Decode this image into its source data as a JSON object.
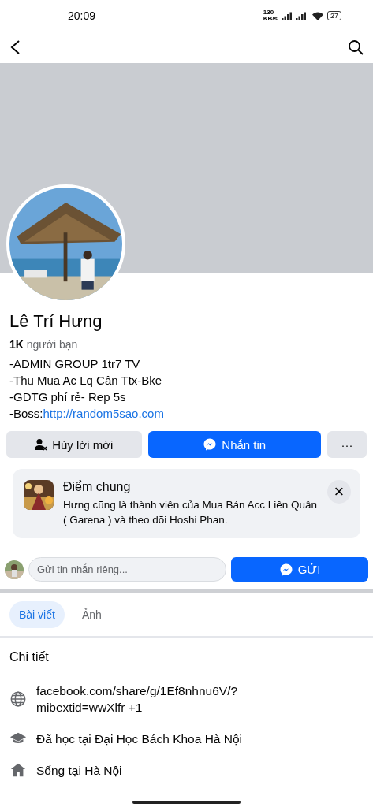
{
  "status_bar": {
    "time": "20:09",
    "speed": "130",
    "speed_unit": "KB/s",
    "battery": "27"
  },
  "profile": {
    "name": "Lê Trí Hưng",
    "friends": "**1K** người bạn",
    "bio": [
      {
        "kind": "text",
        "text": "-ADMIN GROUP 1tr7 TV"
      },
      {
        "kind": "text",
        "text": "-Thu Mua Ac Lq Cân Ttx-Bke"
      },
      {
        "kind": "text",
        "text": "-GDTG phí rẻ- Rep 5s"
      },
      {
        "kind": "link",
        "text": "-Boss:",
        "link": "http://random5sao.com"
      }
    ]
  },
  "actions": {
    "cancel": "Hủy lời mời",
    "message": "Nhắn tin",
    "more": "···"
  },
  "common": {
    "title": "Điểm chung",
    "text": "Hưng cũng là thành viên của Mua Bán Acc Liên Quân ( Garena ) và theo dõi Hoshi Phan.",
    "close": "×"
  },
  "composer": {
    "placeholder": "Gửi tin nhắn riêng...",
    "send": "GỬI"
  },
  "tabs": [
    {
      "label": "Bài viết",
      "selected": true
    },
    {
      "label": "Ảnh",
      "selected": false
    }
  ],
  "details": {
    "title": "Chi tiết",
    "items": [
      {
        "kind": "web",
        "text": "facebook.com/share/g/1Ef8nhnu6V/?\nmibextid=wwXlfr +1"
      },
      {
        "kind": "school",
        "text": "Đã học tại Đại Học Bách Khoa Hà Nội"
      },
      {
        "kind": "home",
        "text": "Sống tại Hà Nội"
      }
    ]
  }
}
